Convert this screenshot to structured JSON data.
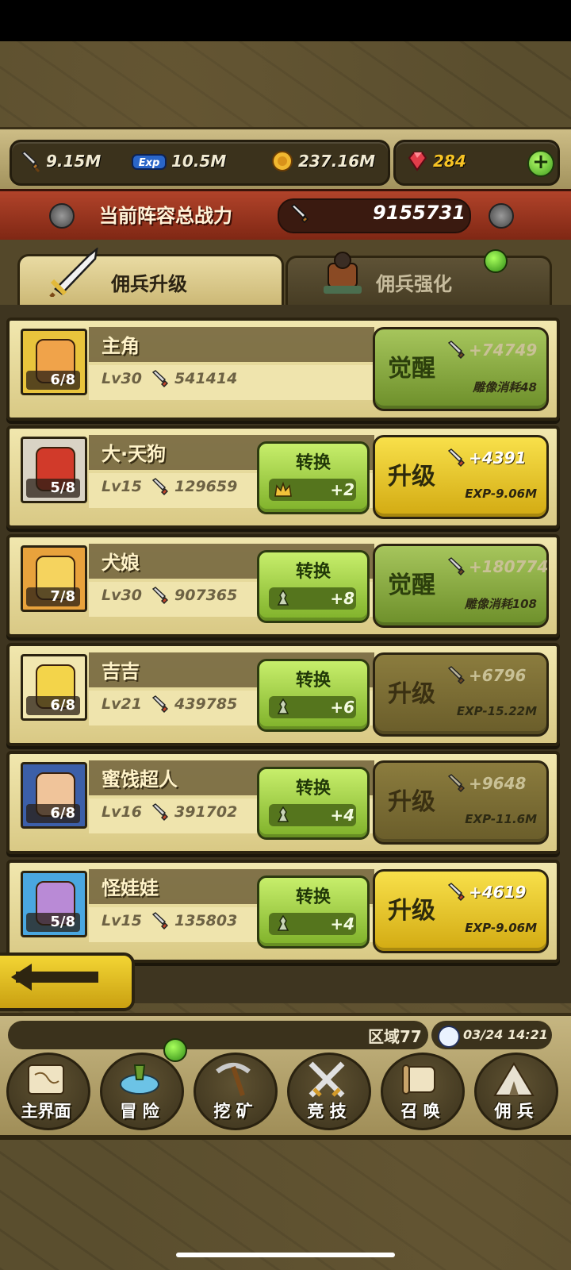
{
  "resources": {
    "attack": "9.15M",
    "exp": "10.5M",
    "gold": "237.16M",
    "gems": "284",
    "exp_icon_text": "Exp",
    "plus": "+"
  },
  "power_banner": {
    "label": "当前阵容总战力",
    "value": "9155731"
  },
  "tabs": [
    {
      "label": "佣兵升级",
      "active": true
    },
    {
      "label": "佣兵强化",
      "active": false
    }
  ],
  "heroes": [
    {
      "name": "主角",
      "level": "Lv30",
      "power": "541414",
      "stars": "6/8",
      "convert": null,
      "action": {
        "type": "awaken",
        "label": "觉醒",
        "power_gain": "+74749",
        "cost": "雕像消耗48"
      }
    },
    {
      "name": "大·天狗",
      "level": "Lv15",
      "power": "129659",
      "stars": "5/8",
      "convert": {
        "label": "转换",
        "value": "+2"
      },
      "action": {
        "type": "upgrade",
        "label": "升级",
        "power_gain": "+4391",
        "cost": "EXP-9.06M"
      }
    },
    {
      "name": "犬娘",
      "level": "Lv30",
      "power": "907365",
      "stars": "7/8",
      "convert": {
        "label": "转换",
        "value": "+8"
      },
      "action": {
        "type": "awaken",
        "label": "觉醒",
        "power_gain": "+180774",
        "cost": "雕像消耗108"
      }
    },
    {
      "name": "吉吉",
      "level": "Lv21",
      "power": "439785",
      "stars": "6/8",
      "convert": {
        "label": "转换",
        "value": "+6"
      },
      "action": {
        "type": "disabled",
        "label": "升级",
        "power_gain": "+6796",
        "cost": "EXP-15.22M"
      }
    },
    {
      "name": "蜜饯超人",
      "level": "Lv16",
      "power": "391702",
      "stars": "6/8",
      "convert": {
        "label": "转换",
        "value": "+4"
      },
      "action": {
        "type": "disabled",
        "label": "升级",
        "power_gain": "+9648",
        "cost": "EXP-11.6M"
      }
    },
    {
      "name": "怪娃娃",
      "level": "Lv15",
      "power": "135803",
      "stars": "5/8",
      "convert": {
        "label": "转换",
        "value": "+4"
      },
      "action": {
        "type": "upgrade",
        "label": "升级",
        "power_gain": "+4619",
        "cost": "EXP-9.06M"
      }
    }
  ],
  "footer": {
    "region": "区域77",
    "time": "03/24 14:21"
  },
  "nav": [
    {
      "label": "主界面",
      "icon": "map-scroll-icon"
    },
    {
      "label": "冒 险",
      "icon": "floating-island-icon"
    },
    {
      "label": "挖 矿",
      "icon": "pickaxe-icon"
    },
    {
      "label": "竞 技",
      "icon": "crossed-swords-icon"
    },
    {
      "label": "召 唤",
      "icon": "summon-scroll-icon"
    },
    {
      "label": "佣 兵",
      "icon": "tent-icon"
    }
  ],
  "colors": {
    "gem": "#f6c324",
    "banner": "#9c3520",
    "button_green": "#9fcf48",
    "button_yellow": "#f0cf2a"
  }
}
